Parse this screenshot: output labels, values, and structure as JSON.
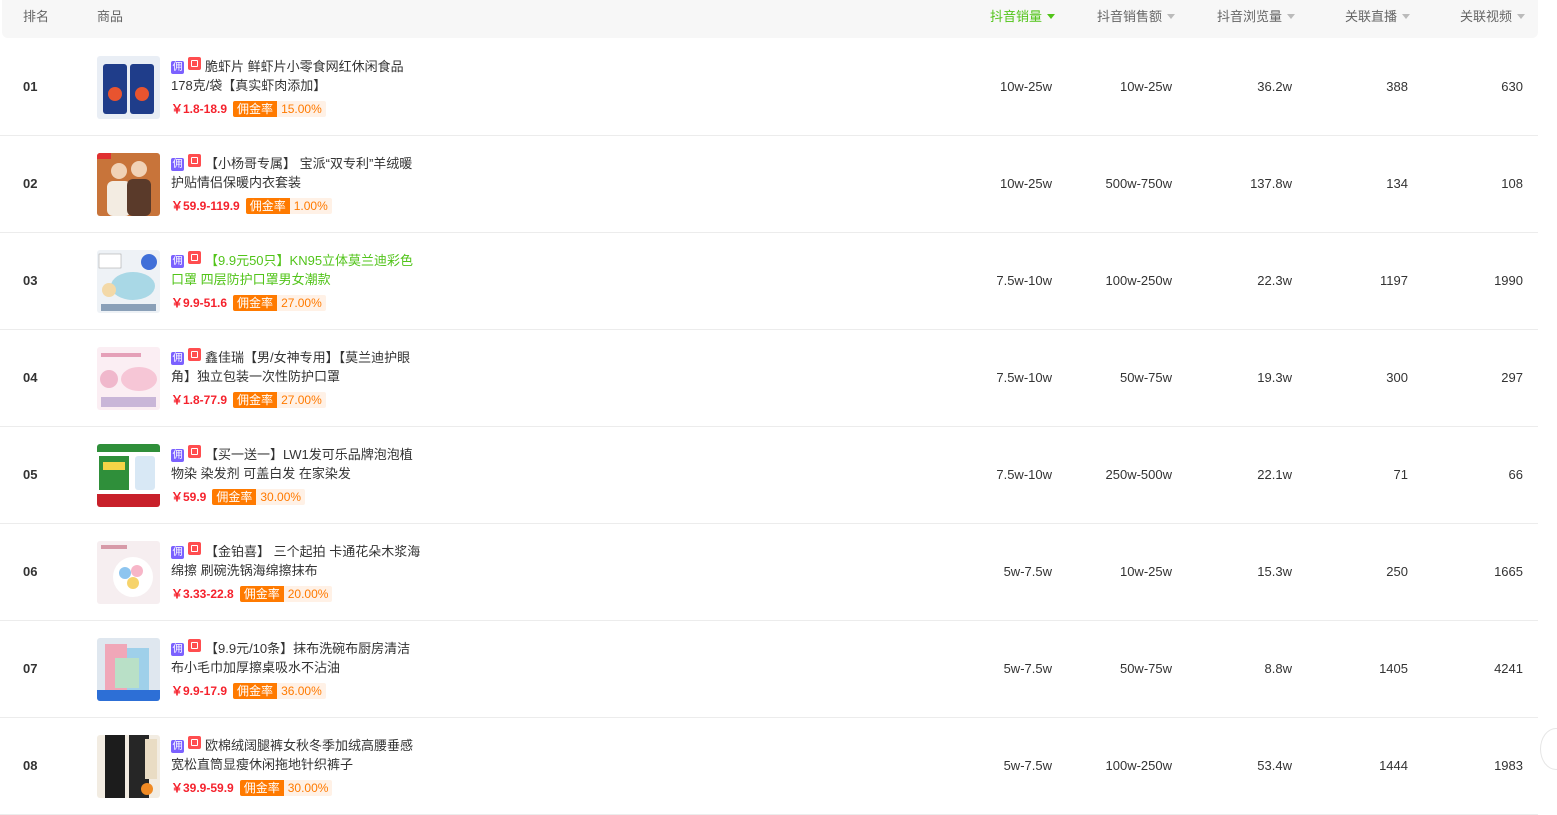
{
  "header": {
    "rank": "排名",
    "product": "商品",
    "columns": [
      {
        "key": "sales",
        "label": "抖音销量",
        "active": true
      },
      {
        "key": "revenue",
        "label": "抖音销售额",
        "active": false
      },
      {
        "key": "views",
        "label": "抖音浏览量",
        "active": false
      },
      {
        "key": "live",
        "label": "关联直播",
        "active": false
      },
      {
        "key": "video",
        "label": "关联视频",
        "active": false
      }
    ]
  },
  "labels": {
    "yong": "佣",
    "rate_label": "佣金率"
  },
  "colors": {
    "accent_green": "#52c41a",
    "price_red": "#f5222d",
    "rate_orange": "#ff7a00",
    "yong_purple": "#7b61ff",
    "shop_red": "#ff4d4f"
  },
  "rows": [
    {
      "rank": "01",
      "title": "脆虾片 鲜虾片小零食网红休闲食品178克/袋【真实虾肉添加】",
      "highlight": false,
      "price": "￥1.8-18.9",
      "rate": "15.00%",
      "sales": "10w-25w",
      "revenue": "10w-25w",
      "views": "36.2w",
      "live": "388",
      "video": "630",
      "thumb": "shrimp-chips-image"
    },
    {
      "rank": "02",
      "title": "【小杨哥专属】 宝派“双专利”羊绒暖护贴情侣保暖内衣套装",
      "highlight": false,
      "price": "￥59.9-119.9",
      "rate": "1.00%",
      "sales": "10w-25w",
      "revenue": "500w-750w",
      "views": "137.8w",
      "live": "134",
      "video": "108",
      "thumb": "couple-thermal-underwear-image"
    },
    {
      "rank": "03",
      "title": "【9.9元50只】KN95立体莫兰迪彩色口罩 四层防护口罩男女潮款",
      "highlight": true,
      "price": "￥9.9-51.6",
      "rate": "27.00%",
      "sales": "7.5w-10w",
      "revenue": "100w-250w",
      "views": "22.3w",
      "live": "1197",
      "video": "1990",
      "thumb": "kn95-mask-image"
    },
    {
      "rank": "04",
      "title": "鑫佳瑞【男/女神专用】【莫兰迪护眼角】独立包装一次性防护口罩",
      "highlight": false,
      "price": "￥1.8-77.9",
      "rate": "27.00%",
      "sales": "7.5w-10w",
      "revenue": "50w-75w",
      "views": "19.3w",
      "live": "300",
      "video": "297",
      "thumb": "disposable-mask-image"
    },
    {
      "rank": "05",
      "title": "【买一送一】LW1发可乐品牌泡泡植物染 染发剂 可盖白发 在家染发",
      "highlight": false,
      "price": "￥59.9",
      "rate": "30.00%",
      "sales": "7.5w-10w",
      "revenue": "250w-500w",
      "views": "22.1w",
      "live": "71",
      "video": "66",
      "thumb": "hair-dye-image"
    },
    {
      "rank": "06",
      "title": "【金铂喜】 三个起拍 卡通花朵木浆海绵擦 刷碗洗锅海绵擦抹布",
      "highlight": false,
      "price": "￥3.33-22.8",
      "rate": "20.00%",
      "sales": "5w-7.5w",
      "revenue": "10w-25w",
      "views": "15.3w",
      "live": "250",
      "video": "1665",
      "thumb": "flower-sponge-image"
    },
    {
      "rank": "07",
      "title": "【9.9元/10条】抹布洗碗布厨房清洁布小毛巾加厚擦桌吸水不沾油",
      "highlight": false,
      "price": "￥9.9-17.9",
      "rate": "36.00%",
      "sales": "5w-7.5w",
      "revenue": "50w-75w",
      "views": "8.8w",
      "live": "1405",
      "video": "4241",
      "thumb": "dish-cloth-image"
    },
    {
      "rank": "08",
      "title": "欧棉绒阔腿裤女秋冬季加绒高腰垂感宽松直筒显瘦休闲拖地针织裤子",
      "highlight": false,
      "price": "￥39.9-59.9",
      "rate": "30.00%",
      "sales": "5w-7.5w",
      "revenue": "100w-250w",
      "views": "53.4w",
      "live": "1444",
      "video": "1983",
      "thumb": "wide-leg-pants-image"
    }
  ]
}
